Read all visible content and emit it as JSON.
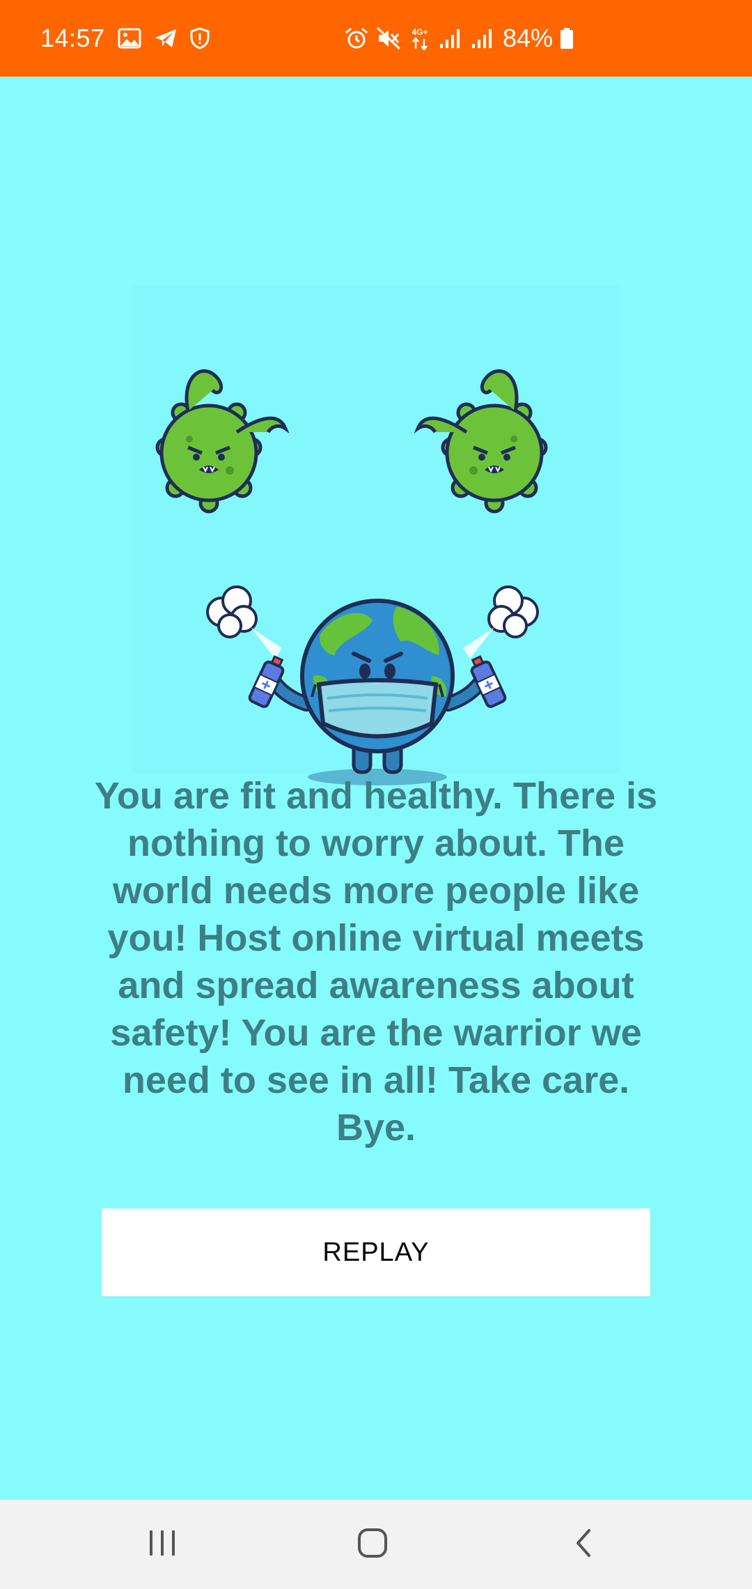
{
  "status_bar": {
    "time": "14:57",
    "battery_percent": "84%",
    "network_label": "4G+",
    "background_color": "#FF6600",
    "left_icons": [
      "gallery-icon",
      "telegram-icon",
      "shield-icon"
    ],
    "right_icons": [
      "alarm-icon",
      "vibrate-mute-icon",
      "network-4g-icon",
      "signal-icon",
      "signal-icon",
      "battery-icon"
    ]
  },
  "main": {
    "background_color": "#85FBFE",
    "illustration": "earth-with-mask-fighting-viruses",
    "message": "You are fit and healthy. There is nothing to worry about. The world needs more people like you! Host online virtual meets and spread awareness about safety! You are the warrior we need to see in all! Take care. Bye.",
    "message_color": "#3C7F84",
    "replay_label": "REPLAY"
  },
  "nav_bar": {
    "icons": [
      "recent-apps-icon",
      "home-icon",
      "back-icon"
    ]
  }
}
